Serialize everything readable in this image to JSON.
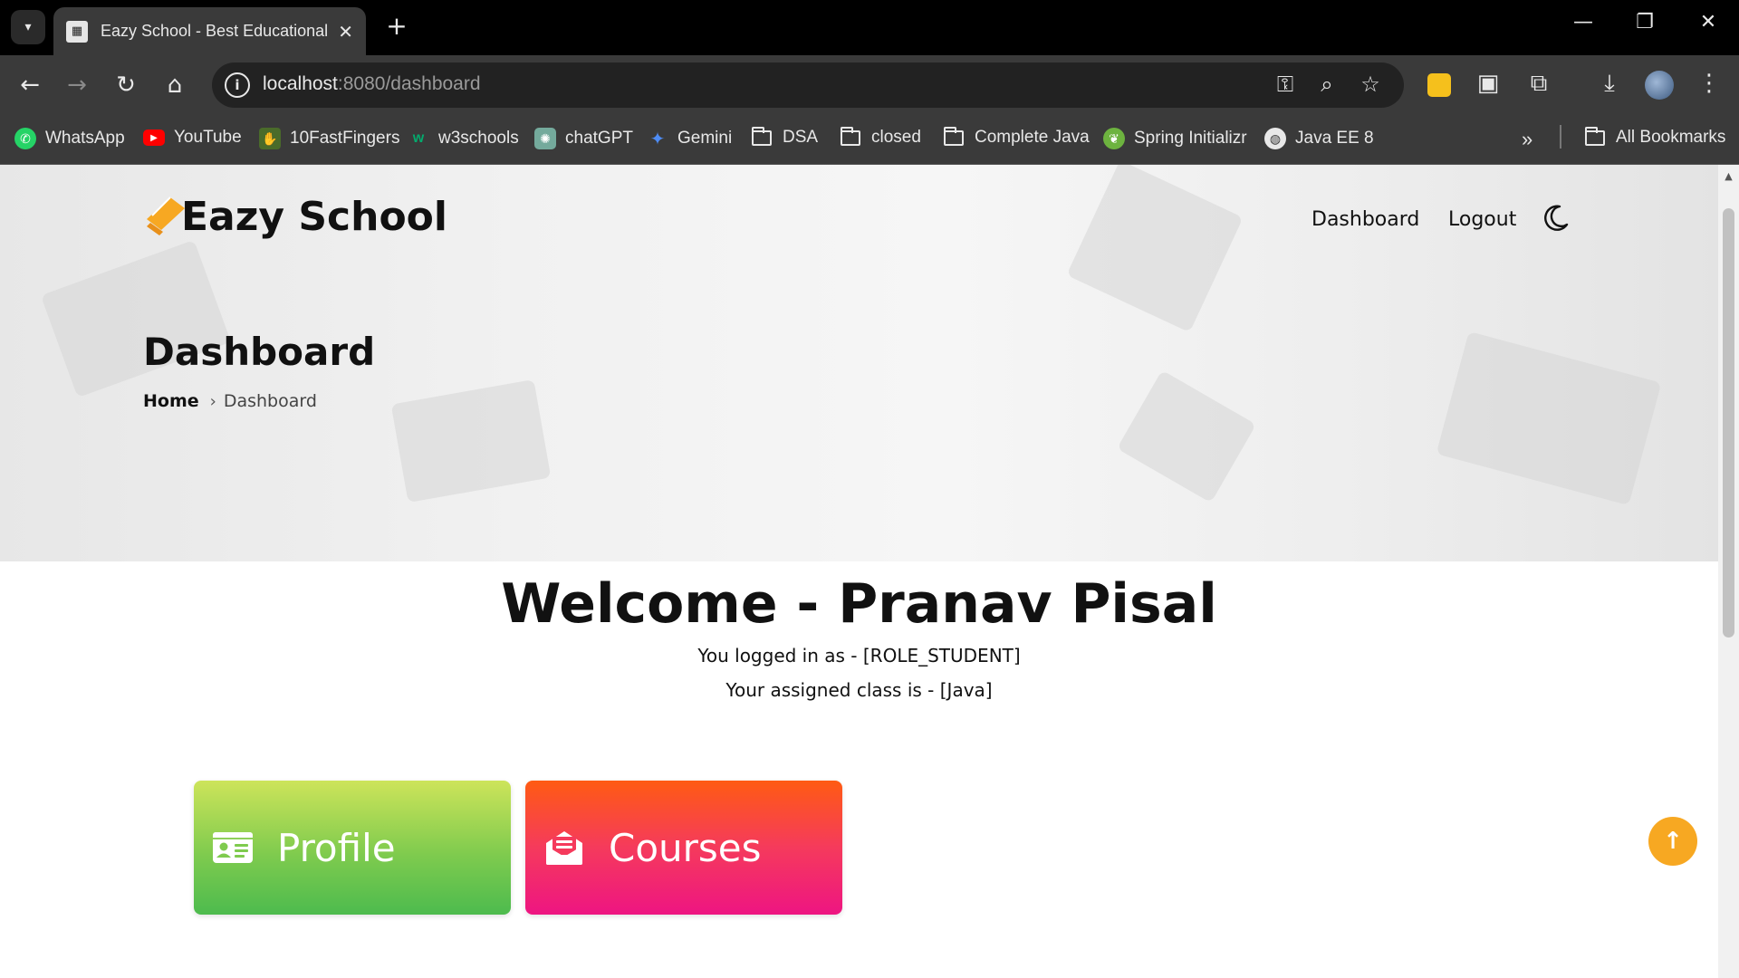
{
  "browser": {
    "tab_title": "Eazy School - Best Educational Institute",
    "url_host": "localhost",
    "url_rest": ":8080/dashboard",
    "bookmarks": [
      "WhatsApp",
      "YouTube",
      "10FastFingers",
      "w3schools",
      "chatGPT",
      "Gemini",
      "DSA",
      "closed",
      "Complete Java",
      "Spring Initializr",
      "Java EE 8"
    ],
    "all_bookmarks": "All Bookmarks"
  },
  "header": {
    "logo": "Eazy School",
    "nav": {
      "dashboard": "Dashboard",
      "logout": "Logout"
    }
  },
  "hero": {
    "title": "Dashboard",
    "breadcrumb": {
      "home": "Home",
      "current": "Dashboard"
    }
  },
  "welcome": {
    "heading": "Welcome - Pranav Pisal",
    "role_line": "You logged in as - [ROLE_STUDENT]",
    "class_line": "Your assigned class is - [Java]"
  },
  "cards": {
    "profile": "Profile",
    "courses": "Courses"
  },
  "colors": {
    "accent": "#f7a822",
    "profile_card": "#4dbb4e",
    "courses_card": "#ee1582"
  }
}
